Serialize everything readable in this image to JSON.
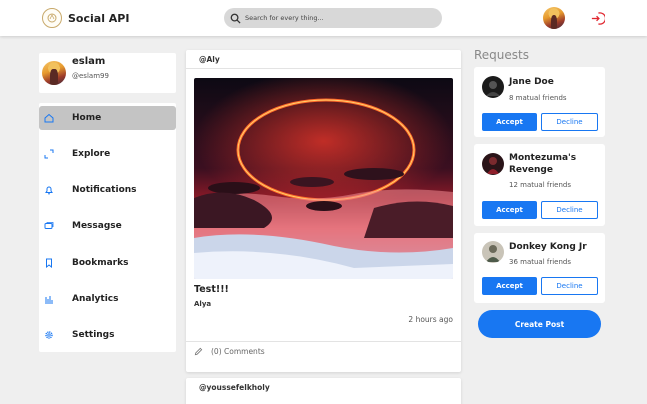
{
  "app": {
    "title": "Social API"
  },
  "search": {
    "placeholder": "Search for every thing..."
  },
  "profile": {
    "name": "eslam",
    "handle": "@eslam99"
  },
  "nav": [
    {
      "label": "Home",
      "icon": "home-icon",
      "active": true
    },
    {
      "label": "Explore",
      "icon": "explore-icon"
    },
    {
      "label": "Notifications",
      "icon": "bell-icon"
    },
    {
      "label": "Messagse",
      "icon": "message-icon"
    },
    {
      "label": "Bookmarks",
      "icon": "bookmark-icon"
    },
    {
      "label": "Analytics",
      "icon": "analytics-icon"
    },
    {
      "label": "Settings",
      "icon": "gear-icon"
    }
  ],
  "posts": [
    {
      "author": "@Aly",
      "title": "Test!!!",
      "subtitle": "Alya",
      "time": "2 hours ago",
      "comments": "(0) Comments"
    },
    {
      "author": "@youssefelkholy"
    }
  ],
  "requests": {
    "title": "Requests",
    "items": [
      {
        "name": "Jane Doe",
        "friends": "8 matual friends"
      },
      {
        "name": "Montezuma's Revenge",
        "friends": "12 matual friends"
      },
      {
        "name": "Donkey Kong Jr",
        "friends": "36 matual friends"
      }
    ],
    "accept_label": "Accept",
    "decline_label": "Decline"
  },
  "create_post_label": "Create Post",
  "colors": {
    "accent": "#1877f2",
    "logout": "#e0262f",
    "active_nav": "#c4c4c4"
  }
}
